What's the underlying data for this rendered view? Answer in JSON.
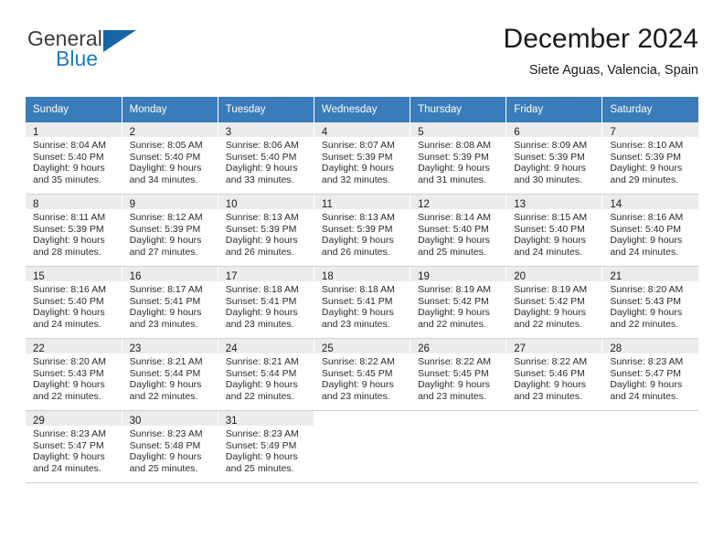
{
  "brand": {
    "name_top": "General",
    "name_bottom": "Blue",
    "accent_color": "#1f7bc1",
    "triangle_color": "#1565a8",
    "triangle_icon": "triangle-icon"
  },
  "header": {
    "title": "December 2024",
    "location": "Siete Aguas, Valencia, Spain"
  },
  "calendar": {
    "header_bg": "#3a7cba",
    "header_text_color": "#ffffff",
    "daynum_band_bg": "#ececec",
    "weekdays": [
      "Sunday",
      "Monday",
      "Tuesday",
      "Wednesday",
      "Thursday",
      "Friday",
      "Saturday"
    ],
    "weeks": [
      [
        {
          "day": "1",
          "lines": [
            "Sunrise: 8:04 AM",
            "Sunset: 5:40 PM",
            "Daylight: 9 hours",
            "and 35 minutes."
          ]
        },
        {
          "day": "2",
          "lines": [
            "Sunrise: 8:05 AM",
            "Sunset: 5:40 PM",
            "Daylight: 9 hours",
            "and 34 minutes."
          ]
        },
        {
          "day": "3",
          "lines": [
            "Sunrise: 8:06 AM",
            "Sunset: 5:40 PM",
            "Daylight: 9 hours",
            "and 33 minutes."
          ]
        },
        {
          "day": "4",
          "lines": [
            "Sunrise: 8:07 AM",
            "Sunset: 5:39 PM",
            "Daylight: 9 hours",
            "and 32 minutes."
          ]
        },
        {
          "day": "5",
          "lines": [
            "Sunrise: 8:08 AM",
            "Sunset: 5:39 PM",
            "Daylight: 9 hours",
            "and 31 minutes."
          ]
        },
        {
          "day": "6",
          "lines": [
            "Sunrise: 8:09 AM",
            "Sunset: 5:39 PM",
            "Daylight: 9 hours",
            "and 30 minutes."
          ]
        },
        {
          "day": "7",
          "lines": [
            "Sunrise: 8:10 AM",
            "Sunset: 5:39 PM",
            "Daylight: 9 hours",
            "and 29 minutes."
          ]
        }
      ],
      [
        {
          "day": "8",
          "lines": [
            "Sunrise: 8:11 AM",
            "Sunset: 5:39 PM",
            "Daylight: 9 hours",
            "and 28 minutes."
          ]
        },
        {
          "day": "9",
          "lines": [
            "Sunrise: 8:12 AM",
            "Sunset: 5:39 PM",
            "Daylight: 9 hours",
            "and 27 minutes."
          ]
        },
        {
          "day": "10",
          "lines": [
            "Sunrise: 8:13 AM",
            "Sunset: 5:39 PM",
            "Daylight: 9 hours",
            "and 26 minutes."
          ]
        },
        {
          "day": "11",
          "lines": [
            "Sunrise: 8:13 AM",
            "Sunset: 5:39 PM",
            "Daylight: 9 hours",
            "and 26 minutes."
          ]
        },
        {
          "day": "12",
          "lines": [
            "Sunrise: 8:14 AM",
            "Sunset: 5:40 PM",
            "Daylight: 9 hours",
            "and 25 minutes."
          ]
        },
        {
          "day": "13",
          "lines": [
            "Sunrise: 8:15 AM",
            "Sunset: 5:40 PM",
            "Daylight: 9 hours",
            "and 24 minutes."
          ]
        },
        {
          "day": "14",
          "lines": [
            "Sunrise: 8:16 AM",
            "Sunset: 5:40 PM",
            "Daylight: 9 hours",
            "and 24 minutes."
          ]
        }
      ],
      [
        {
          "day": "15",
          "lines": [
            "Sunrise: 8:16 AM",
            "Sunset: 5:40 PM",
            "Daylight: 9 hours",
            "and 24 minutes."
          ]
        },
        {
          "day": "16",
          "lines": [
            "Sunrise: 8:17 AM",
            "Sunset: 5:41 PM",
            "Daylight: 9 hours",
            "and 23 minutes."
          ]
        },
        {
          "day": "17",
          "lines": [
            "Sunrise: 8:18 AM",
            "Sunset: 5:41 PM",
            "Daylight: 9 hours",
            "and 23 minutes."
          ]
        },
        {
          "day": "18",
          "lines": [
            "Sunrise: 8:18 AM",
            "Sunset: 5:41 PM",
            "Daylight: 9 hours",
            "and 23 minutes."
          ]
        },
        {
          "day": "19",
          "lines": [
            "Sunrise: 8:19 AM",
            "Sunset: 5:42 PM",
            "Daylight: 9 hours",
            "and 22 minutes."
          ]
        },
        {
          "day": "20",
          "lines": [
            "Sunrise: 8:19 AM",
            "Sunset: 5:42 PM",
            "Daylight: 9 hours",
            "and 22 minutes."
          ]
        },
        {
          "day": "21",
          "lines": [
            "Sunrise: 8:20 AM",
            "Sunset: 5:43 PM",
            "Daylight: 9 hours",
            "and 22 minutes."
          ]
        }
      ],
      [
        {
          "day": "22",
          "lines": [
            "Sunrise: 8:20 AM",
            "Sunset: 5:43 PM",
            "Daylight: 9 hours",
            "and 22 minutes."
          ]
        },
        {
          "day": "23",
          "lines": [
            "Sunrise: 8:21 AM",
            "Sunset: 5:44 PM",
            "Daylight: 9 hours",
            "and 22 minutes."
          ]
        },
        {
          "day": "24",
          "lines": [
            "Sunrise: 8:21 AM",
            "Sunset: 5:44 PM",
            "Daylight: 9 hours",
            "and 22 minutes."
          ]
        },
        {
          "day": "25",
          "lines": [
            "Sunrise: 8:22 AM",
            "Sunset: 5:45 PM",
            "Daylight: 9 hours",
            "and 23 minutes."
          ]
        },
        {
          "day": "26",
          "lines": [
            "Sunrise: 8:22 AM",
            "Sunset: 5:45 PM",
            "Daylight: 9 hours",
            "and 23 minutes."
          ]
        },
        {
          "day": "27",
          "lines": [
            "Sunrise: 8:22 AM",
            "Sunset: 5:46 PM",
            "Daylight: 9 hours",
            "and 23 minutes."
          ]
        },
        {
          "day": "28",
          "lines": [
            "Sunrise: 8:23 AM",
            "Sunset: 5:47 PM",
            "Daylight: 9 hours",
            "and 24 minutes."
          ]
        }
      ],
      [
        {
          "day": "29",
          "lines": [
            "Sunrise: 8:23 AM",
            "Sunset: 5:47 PM",
            "Daylight: 9 hours",
            "and 24 minutes."
          ]
        },
        {
          "day": "30",
          "lines": [
            "Sunrise: 8:23 AM",
            "Sunset: 5:48 PM",
            "Daylight: 9 hours",
            "and 25 minutes."
          ]
        },
        {
          "day": "31",
          "lines": [
            "Sunrise: 8:23 AM",
            "Sunset: 5:49 PM",
            "Daylight: 9 hours",
            "and 25 minutes."
          ]
        },
        {
          "day": "",
          "lines": []
        },
        {
          "day": "",
          "lines": []
        },
        {
          "day": "",
          "lines": []
        },
        {
          "day": "",
          "lines": []
        }
      ]
    ]
  }
}
